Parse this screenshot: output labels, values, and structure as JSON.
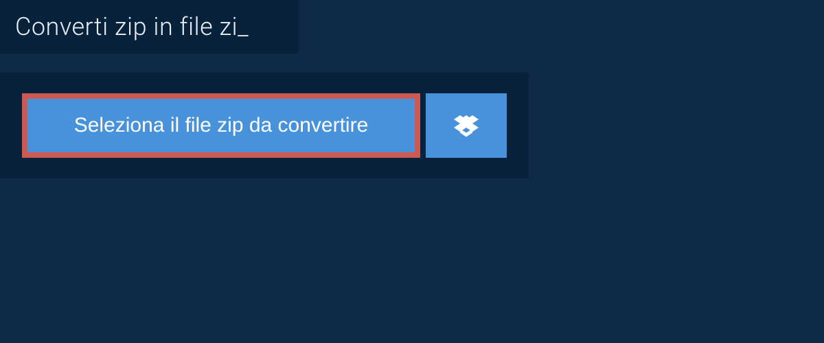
{
  "title": "Converti zip in file zi_",
  "select_button_label": "Seleziona il file zip da convertire",
  "icons": {
    "dropbox": "dropbox-icon"
  }
}
